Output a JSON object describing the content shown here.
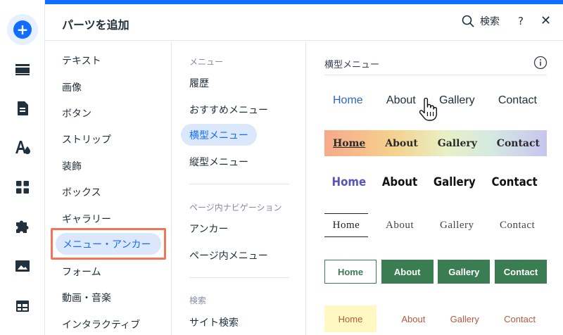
{
  "header": {
    "title": "パーツを追加",
    "search_label": "検索",
    "help_label": "?",
    "close_label": "✕"
  },
  "rail": {
    "items": [
      "add-icon",
      "sections-icon",
      "pages-icon",
      "theme-icon",
      "apps-icon",
      "plugins-icon",
      "media-icon",
      "table-icon"
    ],
    "accent": "#116dff"
  },
  "categories": {
    "items": [
      "テキスト",
      "画像",
      "ボタン",
      "ストリップ",
      "装飾",
      "ボックス",
      "ギャラリー",
      "メニュー・アンカー",
      "フォーム",
      "動画・音楽",
      "インタラクティブ"
    ],
    "selected": "メニュー・アンカー"
  },
  "subcategories": {
    "group1_header": "メニュー",
    "group1_items": [
      "履歴",
      "おすすめメニュー",
      "横型メニュー",
      "縦型メニュー"
    ],
    "selected": "横型メニュー",
    "group2_header": "ページ内ナビゲーション",
    "group2_items": [
      "アンカー",
      "ページ内メニュー"
    ],
    "group3_header": "検索",
    "group3_items": [
      "サイト検索"
    ]
  },
  "preview": {
    "section_title": "横型メニュー",
    "menus": [
      [
        "Home",
        "About",
        "Gallery",
        "Contact"
      ],
      [
        "Home",
        "About",
        "Gallery",
        "Contact"
      ],
      [
        "Home",
        "About",
        "Gallery",
        "Contact"
      ],
      [
        "Home",
        "About",
        "Gallery",
        "Contact"
      ],
      [
        "Home",
        "About",
        "Gallery",
        "Contact"
      ],
      [
        "Home",
        "About",
        "Gallery",
        "Contact"
      ]
    ]
  },
  "colors": {
    "accent": "#116dff",
    "highlight_border": "#f47458",
    "selected_bg": "#dbe7fb",
    "green": "#3b7d52"
  }
}
